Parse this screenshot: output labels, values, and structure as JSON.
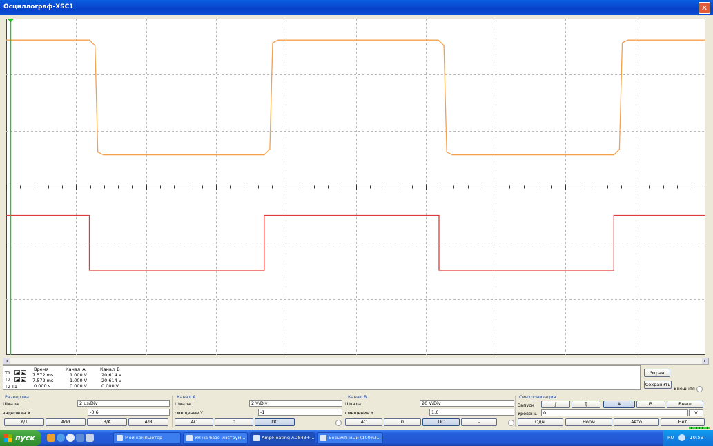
{
  "window": {
    "title": "Осциллограф-XSC1"
  },
  "scope": {
    "colors": {
      "background": "#ffffff",
      "grid": "#b8b8b8",
      "channel_a": "#f5a04a",
      "channel_b": "#e23a3a",
      "cursor": "#22cc22"
    }
  },
  "readout": {
    "headers": [
      "Время",
      "Канал_A",
      "Канал_B"
    ],
    "rows": [
      {
        "label": "T1",
        "values": [
          "7.572 ms",
          "1.000 V",
          "20.614 V"
        ]
      },
      {
        "label": "T2",
        "values": [
          "7.572 ms",
          "1.000 V",
          "20.614 V"
        ]
      },
      {
        "label": "T2-T1",
        "values": [
          "0.000 s",
          "0.000 V",
          "0.000 V"
        ]
      }
    ]
  },
  "right_buttons": {
    "screen": "Экран",
    "save": "Сохранить",
    "external": "Внешняя"
  },
  "timebase": {
    "title": "Развертка",
    "scale_label": "Шкала",
    "scale_value": "2 us/Div",
    "delay_label": "задержка X",
    "delay_value": "-0.6",
    "buttons": [
      "Y/T",
      "Add",
      "B/A",
      "A/B"
    ]
  },
  "channel_a": {
    "title": "Канал A",
    "scale_label": "Шкала",
    "scale_value": "2  V/Div",
    "offset_label": "смещение Y",
    "offset_value": "-1",
    "buttons": [
      "AC",
      "0",
      "DC"
    ]
  },
  "channel_b": {
    "title": "Канал B",
    "scale_label": "Шкала",
    "scale_value": "20  V/Div",
    "offset_label": "смещение Y",
    "offset_value": "1.6",
    "buttons": [
      "AC",
      "0",
      "DC",
      "-"
    ]
  },
  "trigger": {
    "title": "Синхронизация",
    "edge_label": "Запуск",
    "edge_buttons": [
      "ƒ",
      "Ʈ"
    ],
    "source_buttons": [
      "A",
      "B",
      "Внеш"
    ],
    "level_label": "Уровень",
    "level_value": "0",
    "level_unit": "V",
    "mode_buttons": [
      "Одн.",
      "Норм",
      "Авто",
      "Нет"
    ]
  },
  "taskbar": {
    "start_label": "пуск",
    "tasks": [
      "Мой компьютер",
      "УН на базе инструм...",
      "AmpFloating AD843+...",
      "Безымянный (100%)..."
    ],
    "lang": "RU",
    "clock": "10:59"
  }
}
